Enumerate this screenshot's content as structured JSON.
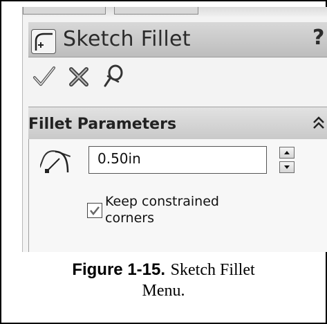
{
  "panel": {
    "title": "Sketch Fillet",
    "help_label": "?"
  },
  "actions": {
    "icons": [
      "checkmark-icon",
      "close-x-icon",
      "pushpin-icon"
    ]
  },
  "section": {
    "title": "Fillet Parameters",
    "radius_value": "0.50in",
    "keep_corners_checked": true,
    "keep_corners_line1": "Keep constrained",
    "keep_corners_line2": "corners"
  },
  "caption": {
    "label": "Figure 1-15.",
    "text_line1": "Sketch Fillet",
    "text_line2": "Menu."
  },
  "colors": {
    "title_bar": "#c8c8c8",
    "section_header": "#d4d4d4",
    "panel_bg": "#f3f3f3"
  }
}
